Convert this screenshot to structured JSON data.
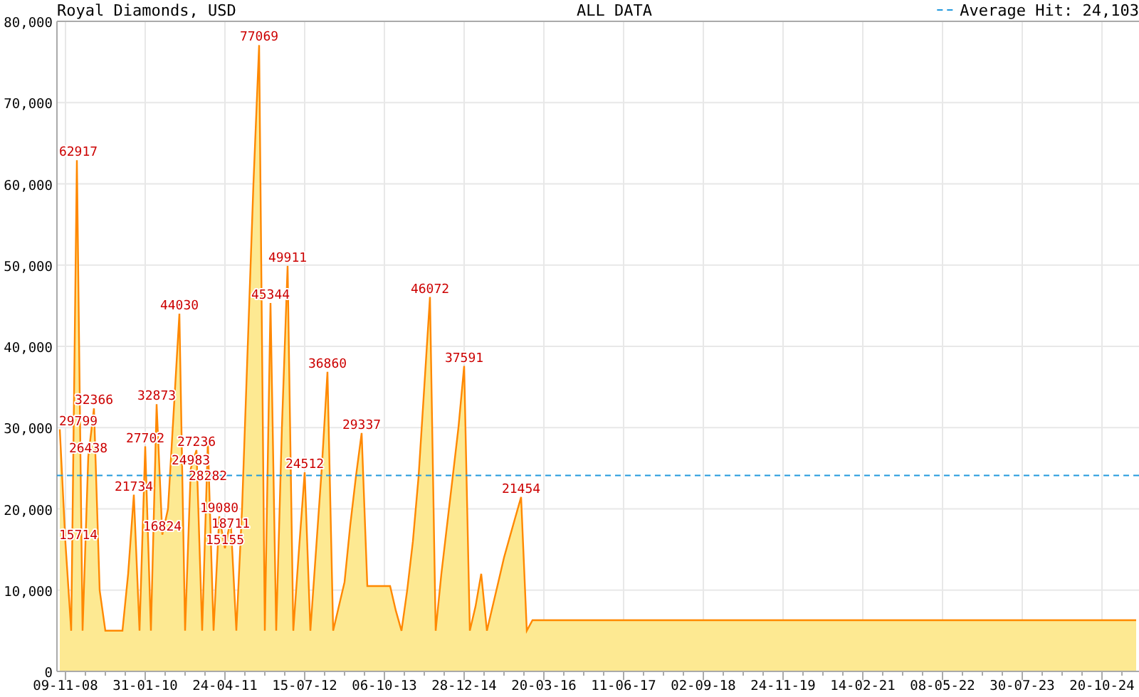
{
  "chart": {
    "subtitle": "ALL DATA",
    "chart_data": {
      "type": "area",
      "title": "Royal Diamonds, USD",
      "categories": [
        null,
        "09-11-08",
        null,
        null,
        null,
        null,
        null,
        null,
        null,
        null,
        null,
        null,
        null,
        null,
        null,
        "31-01-10",
        null,
        null,
        null,
        null,
        null,
        null,
        null,
        null,
        null,
        null,
        null,
        null,
        null,
        "24-04-11",
        null,
        null,
        null,
        null,
        null,
        null,
        null,
        null,
        null,
        null,
        null,
        null,
        null,
        "15-07-12",
        null,
        null,
        null,
        null,
        null,
        null,
        null,
        null,
        null,
        null,
        null,
        null,
        null,
        "06-10-13",
        null,
        null,
        null,
        null,
        null,
        null,
        null,
        null,
        null,
        null,
        null,
        null,
        null,
        "28-12-14",
        null,
        null,
        null,
        null,
        null,
        null,
        null,
        null,
        null,
        null,
        null,
        null,
        null,
        "20-03-16",
        null,
        null,
        null,
        null,
        null,
        null,
        null,
        null,
        null,
        null,
        null,
        null,
        null,
        "11-06-17",
        null,
        null,
        null,
        null,
        null,
        null,
        null,
        null,
        null,
        null,
        null,
        null,
        null,
        "02-09-18",
        null,
        null,
        null,
        null,
        null,
        null,
        null,
        null,
        null,
        null,
        null,
        null,
        null,
        "24-11-19",
        null,
        null,
        null,
        null,
        null,
        null,
        null,
        null,
        null,
        null,
        null,
        null,
        null,
        "14-02-21",
        null,
        null,
        null,
        null,
        null,
        null,
        null,
        null,
        null,
        null,
        null,
        null,
        null,
        "08-05-22",
        null,
        null,
        null,
        null,
        null,
        null,
        null,
        null,
        null,
        null,
        null,
        null,
        null,
        "30-07-23",
        null,
        null,
        null,
        null,
        null,
        null,
        null,
        null,
        null,
        null,
        null,
        null,
        null,
        "20-10-24",
        null,
        null,
        null,
        null,
        null,
        null
      ],
      "series": [
        {
          "color": "#ff8800",
          "values": [
            29799,
            15714,
            5000,
            62917,
            5000,
            26438,
            32366,
            10000,
            5000,
            5000,
            5000,
            5000,
            12000,
            21734,
            5000,
            27702,
            5000,
            32873,
            16824,
            20000,
            32000,
            44030,
            5000,
            24983,
            27236,
            5000,
            28282,
            5000,
            19080,
            15155,
            18711,
            5000,
            20000,
            40000,
            60000,
            77069,
            5000,
            45344,
            5000,
            30000,
            49911,
            5000,
            15000,
            24512,
            5000,
            15000,
            25000,
            36860,
            5000,
            8000,
            11000,
            18000,
            24000,
            29337,
            10500,
            10500,
            10500,
            10500,
            10500,
            7500,
            5000,
            10000,
            16000,
            24000,
            35000,
            46072,
            5000,
            12000,
            18000,
            24000,
            30000,
            37591,
            5000,
            8000,
            12000,
            5000,
            8000,
            11000,
            14000,
            16500,
            19000,
            21454,
            5000,
            6300,
            6300,
            6300,
            6300,
            6300,
            6300,
            6300,
            6300,
            6300,
            6300,
            6300,
            6300,
            6300,
            6300,
            6300,
            6300,
            6300,
            6300,
            6300,
            6300,
            6300,
            6300,
            6300,
            6300,
            6300,
            6300,
            6300,
            6300,
            6300,
            6300,
            6300,
            6300,
            6300,
            6300,
            6300,
            6300,
            6300,
            6300,
            6300,
            6300,
            6300,
            6300,
            6300,
            6300,
            6300,
            6300,
            6300,
            6300,
            6300,
            6300,
            6300,
            6300,
            6300,
            6300,
            6300,
            6300,
            6300,
            6300,
            6300,
            6300,
            6300,
            6300,
            6300,
            6300,
            6300,
            6300,
            6300,
            6300,
            6300,
            6300,
            6300,
            6300,
            6300,
            6300,
            6300,
            6300,
            6300,
            6300,
            6300,
            6300,
            6300,
            6300,
            6300,
            6300,
            6300,
            6300,
            6300,
            6300,
            6300,
            6300,
            6300,
            6300,
            6300,
            6300,
            6300,
            6300,
            6300,
            6300,
            6300,
            6300,
            6300,
            6300,
            6300,
            6300,
            6300,
            6300,
            6300
          ]
        }
      ],
      "ylim": [
        0,
        80000
      ],
      "yticks": [
        {
          "value": 0,
          "label": "0"
        },
        {
          "value": 10000,
          "label": "10,000"
        },
        {
          "value": 20000,
          "label": "20,000"
        },
        {
          "value": 30000,
          "label": "30,000"
        },
        {
          "value": 40000,
          "label": "40,000"
        },
        {
          "value": 50000,
          "label": "50,000"
        },
        {
          "value": 60000,
          "label": "60,000"
        },
        {
          "value": 70000,
          "label": "70,000"
        },
        {
          "value": 80000,
          "label": "80,000"
        }
      ],
      "grid": true,
      "ref_lines": [
        {
          "axis": "y",
          "value": 24103,
          "label": "Average Hit: 24,103"
        }
      ],
      "annotations": [
        {
          "y": 29799,
          "text": "29799"
        },
        {
          "y": 15714,
          "text": "15714"
        },
        {
          "y": 62917,
          "text": "62917"
        },
        {
          "y": 26438,
          "text": "26438"
        },
        {
          "y": 32366,
          "text": "32366"
        },
        {
          "y": 21734,
          "text": "21734"
        },
        {
          "y": 27702,
          "text": "27702"
        },
        {
          "y": 32873,
          "text": "32873"
        },
        {
          "y": 16824,
          "text": "16824"
        },
        {
          "y": 44030,
          "text": "44030"
        },
        {
          "y": 24983,
          "text": "24983"
        },
        {
          "y": 27236,
          "text": "27236"
        },
        {
          "y": 28282,
          "text": "28282"
        },
        {
          "y": 19080,
          "text": "19080"
        },
        {
          "y": 15155,
          "text": "15155"
        },
        {
          "y": 18711,
          "text": "18711"
        },
        {
          "y": 77069,
          "text": "77069"
        },
        {
          "y": 45344,
          "text": "45344"
        },
        {
          "y": 49911,
          "text": "49911"
        },
        {
          "y": 24512,
          "text": "24512"
        },
        {
          "y": 36860,
          "text": "36860"
        },
        {
          "y": 29337,
          "text": "29337"
        },
        {
          "y": 46072,
          "text": "46072"
        },
        {
          "y": 37591,
          "text": "37591"
        },
        {
          "y": 21454,
          "text": "21454"
        }
      ]
    }
  }
}
